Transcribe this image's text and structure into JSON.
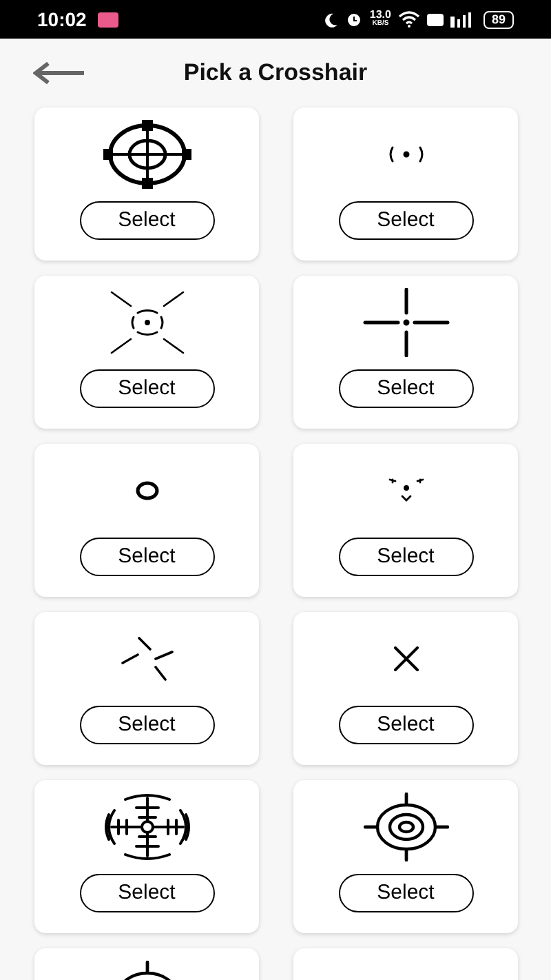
{
  "status_bar": {
    "time": "10:02",
    "net_speed": "13.0",
    "net_unit": "KB/S",
    "battery": "89"
  },
  "header": {
    "title": "Pick a Crosshair"
  },
  "crosshairs": [
    {
      "kind": "scope",
      "button": "Select"
    },
    {
      "kind": "parens",
      "button": "Select"
    },
    {
      "kind": "burst",
      "button": "Select"
    },
    {
      "kind": "cross",
      "button": "Select"
    },
    {
      "kind": "circle",
      "button": "Select"
    },
    {
      "kind": "triad",
      "button": "Select"
    },
    {
      "kind": "pinwheel",
      "button": "Select"
    },
    {
      "kind": "x",
      "button": "Select"
    },
    {
      "kind": "radar",
      "button": "Select"
    },
    {
      "kind": "target",
      "button": "Select"
    },
    {
      "kind": "target"
    },
    {
      "kind": "blank"
    }
  ]
}
